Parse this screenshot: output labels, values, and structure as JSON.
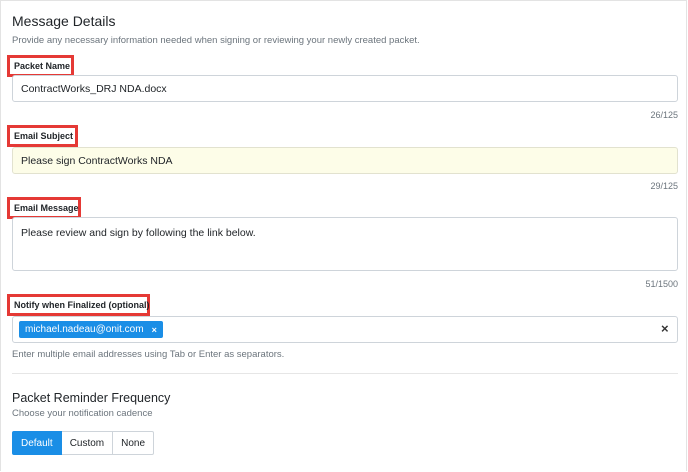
{
  "message_details": {
    "title": "Message Details",
    "description": "Provide any necessary information needed when signing or reviewing your newly created packet."
  },
  "packet_name": {
    "label": "Packet Name",
    "value": "ContractWorks_DRJ NDA.docx",
    "counter": "26/125"
  },
  "email_subject": {
    "label": "Email Subject",
    "value": "Please sign ContractWorks NDA",
    "counter": "29/125"
  },
  "email_message": {
    "label": "Email Message",
    "value": "Please review and sign by following the link below.",
    "counter": "51/1500"
  },
  "notify": {
    "label": "Notify when Finalized (optional)",
    "chips": [
      "michael.nadeau@onit.com"
    ],
    "chip_remove": "×",
    "clear": "×",
    "help": "Enter multiple email addresses using Tab or Enter as separators."
  },
  "reminder": {
    "title": "Packet Reminder Frequency",
    "description": "Choose your notification cadence",
    "options": [
      "Default",
      "Custom",
      "None"
    ],
    "selected": "Default"
  },
  "colors": {
    "accent": "#1a8ee6",
    "highlight_border": "#e53935",
    "subject_bg": "#fdfde8"
  }
}
